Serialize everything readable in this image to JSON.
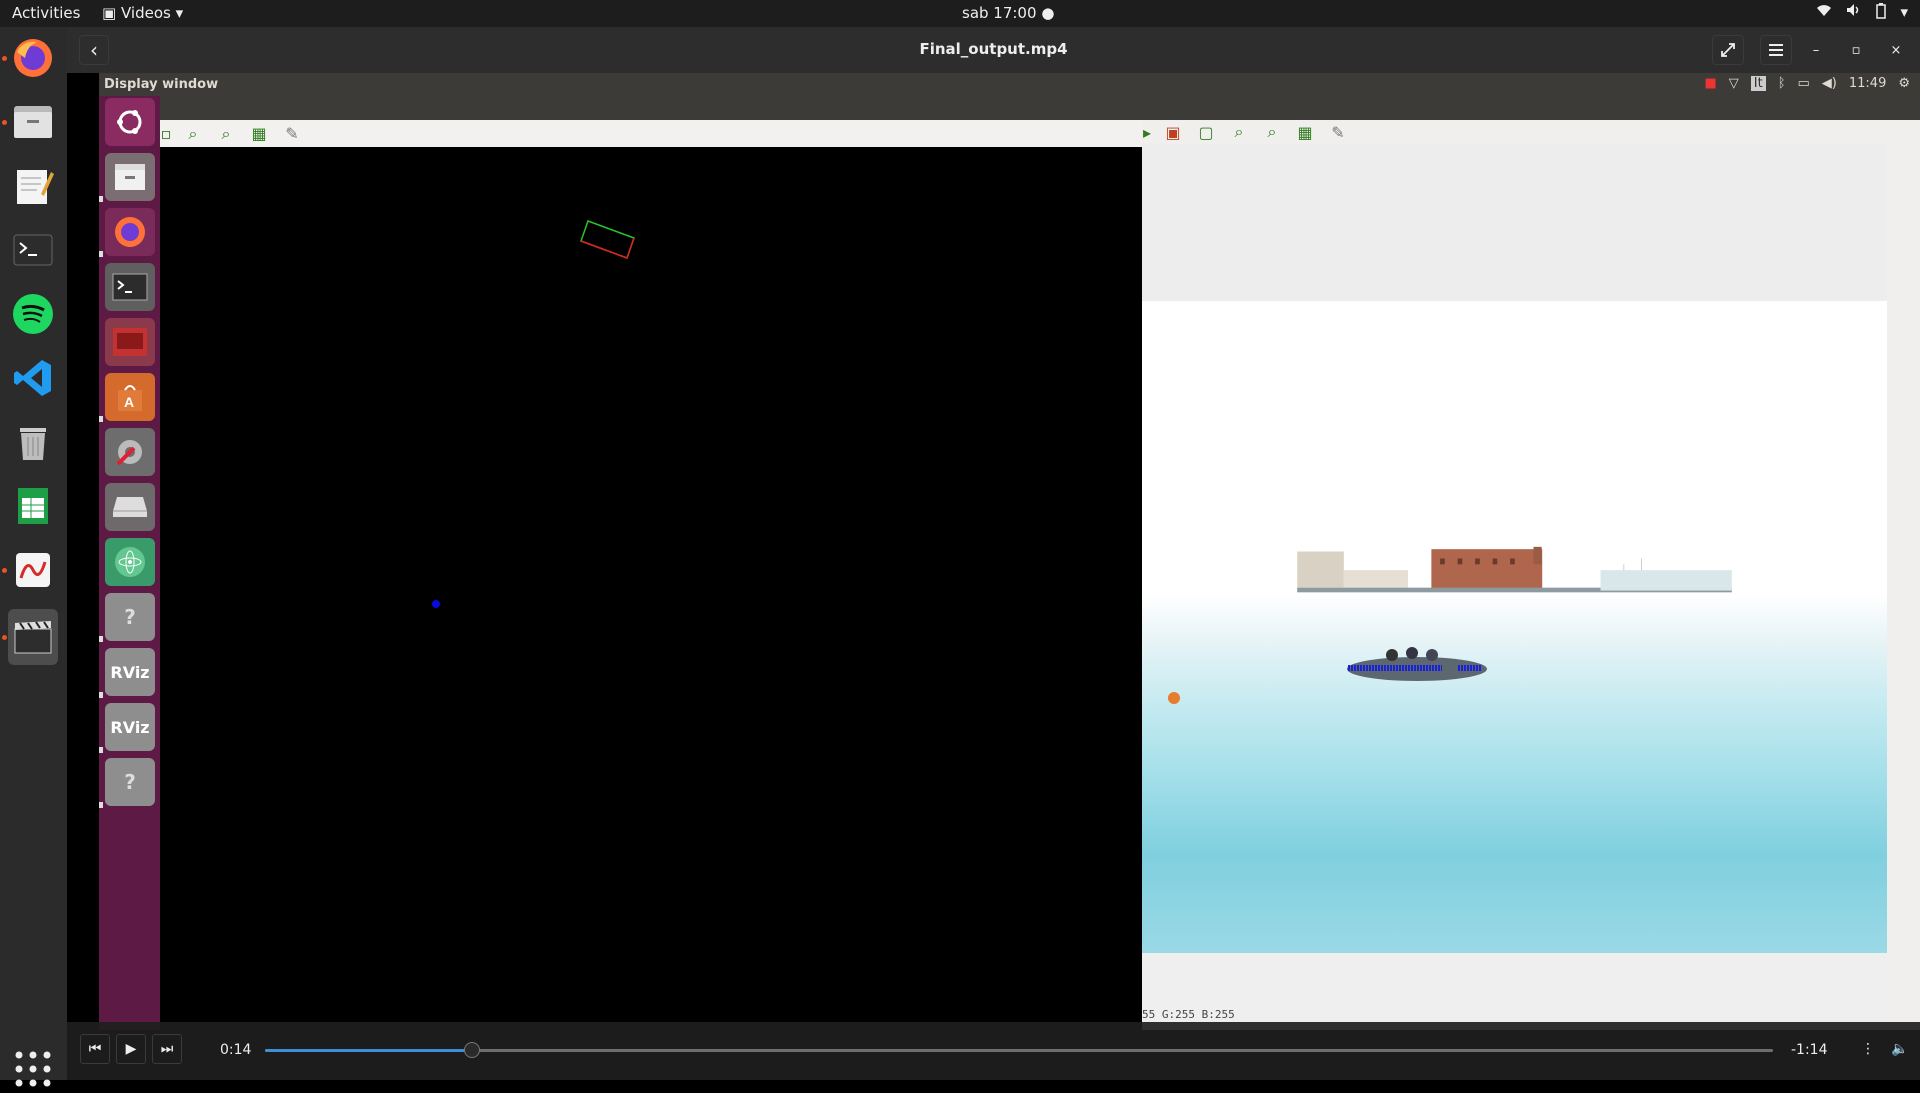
{
  "topbar": {
    "activities": "Activities",
    "app_name": "Videos",
    "clock": "sab 17:00",
    "tray_icons": [
      "wifi-icon",
      "volume-icon",
      "battery-icon",
      "menu-arrow-icon"
    ]
  },
  "dock": {
    "items": [
      {
        "name": "firefox",
        "active": false,
        "running": true
      },
      {
        "name": "files",
        "active": false,
        "running": true
      },
      {
        "name": "text-editor",
        "active": false,
        "running": false
      },
      {
        "name": "terminal",
        "active": false,
        "running": false
      },
      {
        "name": "spotify",
        "active": false,
        "running": false
      },
      {
        "name": "vscode",
        "active": false,
        "running": false
      },
      {
        "name": "trash",
        "active": false,
        "running": false
      },
      {
        "name": "spreadsheet",
        "active": false,
        "running": false
      },
      {
        "name": "document-viewer",
        "active": false,
        "running": true
      },
      {
        "name": "videos",
        "active": true,
        "running": true
      }
    ],
    "show_apps": "apps-grid-icon"
  },
  "header": {
    "title": "Final_output.mp4",
    "back": "back-icon",
    "fullscreen": "fullscreen-icon",
    "menu": "hamburger-icon"
  },
  "video_frame": {
    "window_title": "Display window",
    "tray_time": "11:49",
    "launcher_items": [
      "ubuntu",
      "files",
      "firefox",
      "terminal",
      "presentation",
      "software-center",
      "settings",
      "drive",
      "atom",
      "unknown",
      "RViz",
      "RViz",
      "unknown"
    ],
    "rviz_label": "RViz",
    "pixel_info": "55 G:255 B:255",
    "colors": {
      "launcher": "#5c1a44",
      "panel": "#3c3b37",
      "toolbar_icon": "#2f7d1e"
    }
  },
  "player": {
    "elapsed": "0:14",
    "remaining": "-1:14",
    "progress": 0.137,
    "buttons": [
      "previous-icon",
      "play-icon",
      "next-icon",
      "more-icon",
      "volume-icon"
    ]
  }
}
